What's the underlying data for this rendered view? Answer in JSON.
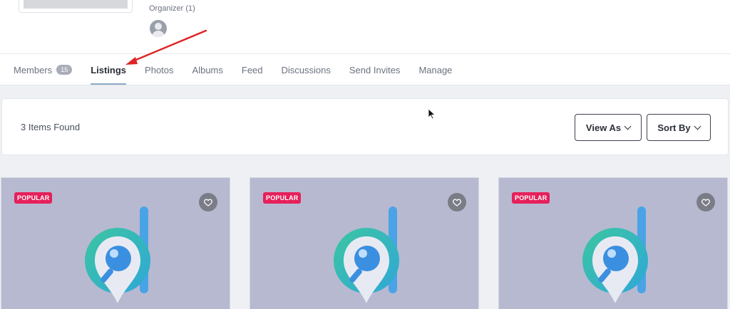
{
  "organizer": {
    "label": "Organizer (1)"
  },
  "tabs": [
    {
      "label": "Members",
      "badge": "15"
    },
    {
      "label": "Listings",
      "active": true
    },
    {
      "label": "Photos"
    },
    {
      "label": "Albums"
    },
    {
      "label": "Feed"
    },
    {
      "label": "Discussions"
    },
    {
      "label": "Send Invites"
    },
    {
      "label": "Manage"
    }
  ],
  "toolbar": {
    "items_found": "3 Items Found",
    "view_as_label": "View As",
    "sort_by_label": "Sort By"
  },
  "listings": [
    {
      "badge": "POPULAR",
      "favorite_icon": "heart-icon"
    },
    {
      "badge": "POPULAR",
      "favorite_icon": "heart-icon"
    },
    {
      "badge": "POPULAR",
      "favorite_icon": "heart-icon"
    }
  ],
  "colors": {
    "accent_badge": "#e6205a",
    "arrow": "#e02424",
    "card_bg": "#b7b9d1"
  }
}
